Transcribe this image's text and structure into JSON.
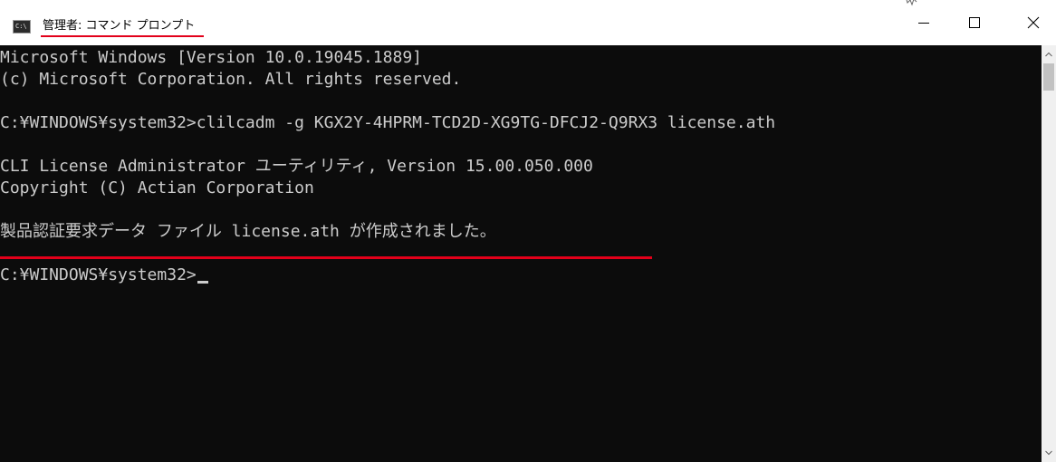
{
  "window": {
    "icon_label": "C:\\",
    "title": "管理者: コマンド プロンプト",
    "controls": {
      "minimize_icon": "minimize-icon",
      "maximize_icon": "maximize-icon",
      "close_icon": "close-icon"
    }
  },
  "console": {
    "lines": [
      "Microsoft Windows [Version 10.0.19045.1889]",
      "(c) Microsoft Corporation. All rights reserved.",
      "C:¥WINDOWS¥system32>clilcadm -g KGX2Y-4HPRM-TCD2D-XG9TG-DFCJ2-Q9RX3 license.ath",
      "CLI License Administrator ユーティリティ, Version 15.00.050.000",
      "Copyright (C) Actian Corporation",
      "製品認証要求データ ファイル license.ath が作成されました。",
      "C:¥WINDOWS¥system32>"
    ]
  },
  "colors": {
    "console_background": "#0c0c0c",
    "console_text": "#cccccc",
    "annotation_underline": "#e2001a",
    "titlebar_background": "#ffffff"
  }
}
